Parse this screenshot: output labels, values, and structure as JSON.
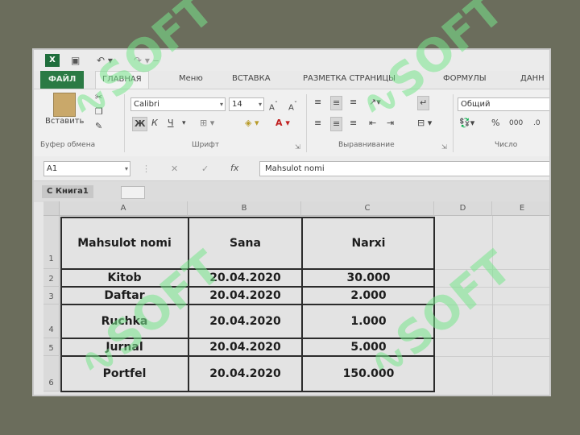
{
  "quick_access": {
    "excel_icon": "excel-icon",
    "save_icon": "save-icon",
    "undo_icon": "undo-icon",
    "redo_icon": "redo-icon"
  },
  "ribbon_tabs": [
    "ФАЙЛ",
    "ГЛАВНАЯ",
    "Меню",
    "ВСТАВКА",
    "РАЗМЕТКА СТРАНИЦЫ",
    "ФОРМУЛЫ",
    "ДАНН"
  ],
  "ribbon": {
    "paste_label": "Вставить",
    "font_name": "Calibri",
    "font_size": "14",
    "number_format": "Общий",
    "group_clipboard": "Буфер обмена",
    "group_font": "Шрифт",
    "group_alignment": "Выравнивание",
    "group_number": "Число",
    "bold_label": "Ж",
    "italic_label": "К",
    "underline_label": "Ч",
    "percent_label": "%",
    "thousands_label": "000"
  },
  "formula_bar": {
    "name_box": "A1",
    "fx_label": "fx",
    "content": "Mahsulot nomi"
  },
  "sheet_tabs": {
    "workbook": "Книга1"
  },
  "columns": [
    "A",
    "B",
    "C",
    "D",
    "E"
  ],
  "rows": [
    "1",
    "2",
    "3",
    "4",
    "5",
    "6"
  ],
  "table": {
    "headers": [
      "Mahsulot nomi",
      "Sana",
      "Narxi"
    ],
    "rows": [
      [
        "Kitob",
        "20.04.2020",
        "30.000"
      ],
      [
        "Daftar",
        "20.04.2020",
        "2.000"
      ],
      [
        "Ruchka",
        "20.04.2020",
        "1.000"
      ],
      [
        "Jurnal",
        "20.04.2020",
        "5.000"
      ],
      [
        "Portfel",
        "20.04.2020",
        "150.000"
      ]
    ]
  },
  "watermark_text": "SOFT"
}
